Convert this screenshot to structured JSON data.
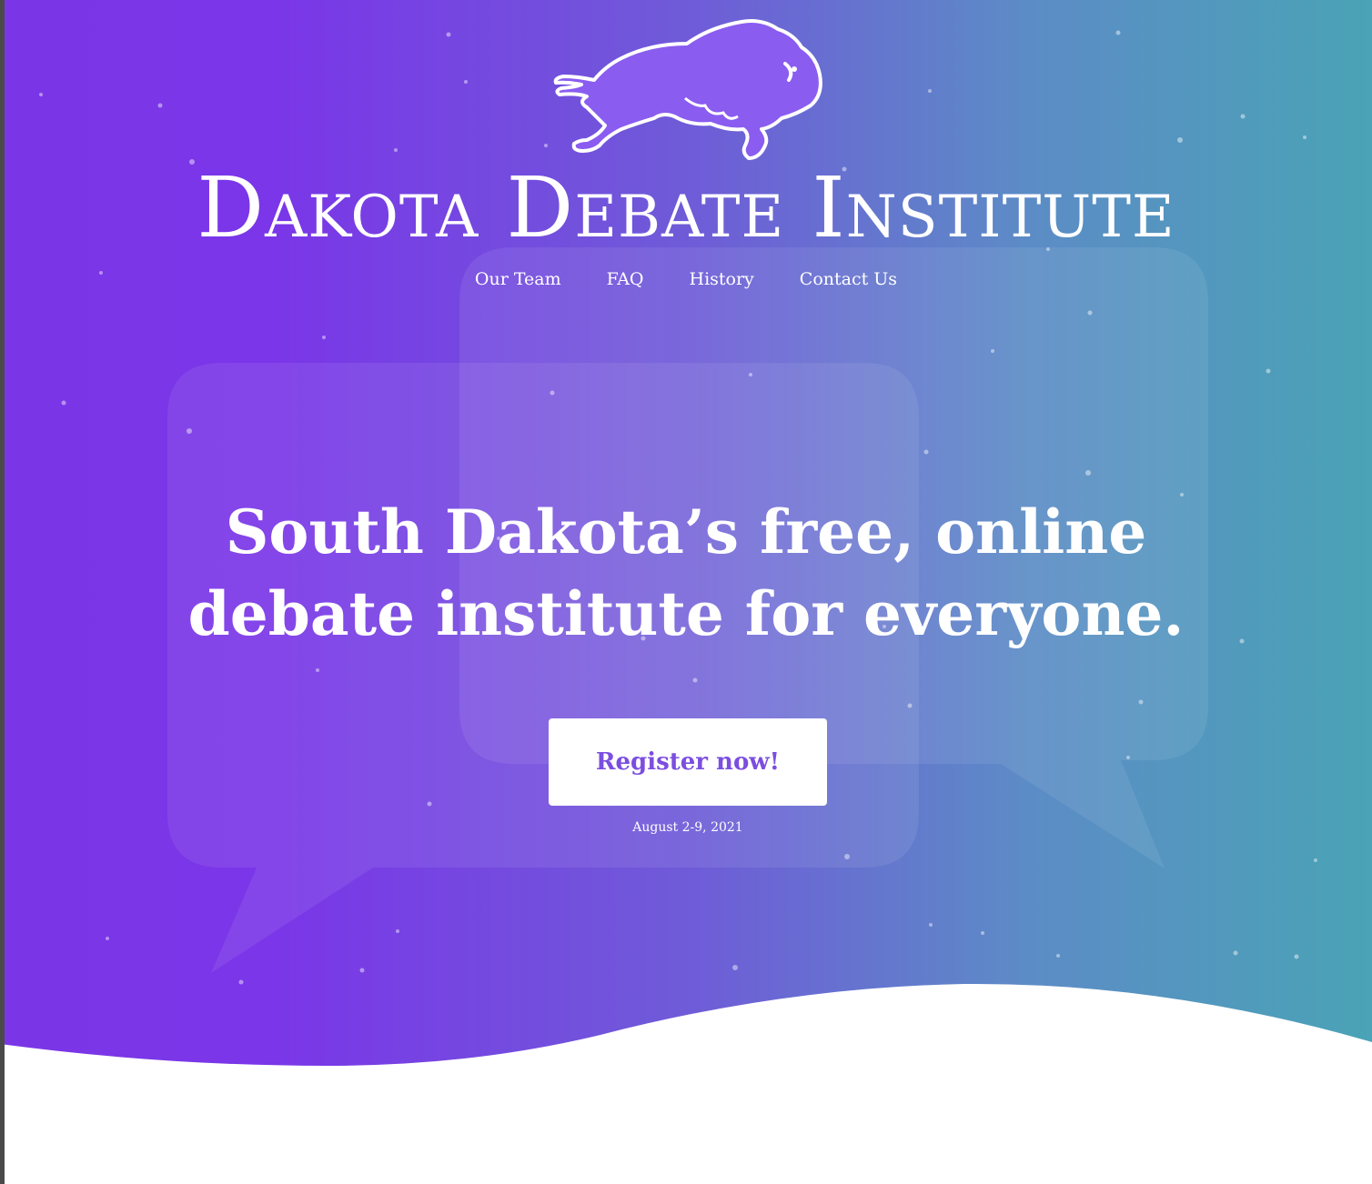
{
  "brand": {
    "title": "Dakota Debate Institute",
    "logo_icon": "bison-icon"
  },
  "nav": {
    "items": [
      {
        "label": "Our Team"
      },
      {
        "label": "FAQ"
      },
      {
        "label": "History"
      },
      {
        "label": "Contact Us"
      }
    ]
  },
  "hero": {
    "headline_line1": "South Dakota’s free, online",
    "headline_line2": "debate institute for everyone.",
    "cta_label": "Register now!",
    "event_date": "August 2-9, 2021"
  },
  "colors": {
    "gradient_start": "#7a36e8",
    "gradient_end": "#4aa3b6",
    "cta_text": "#7b4ee0",
    "logo_fill": "#8a5cf0"
  }
}
